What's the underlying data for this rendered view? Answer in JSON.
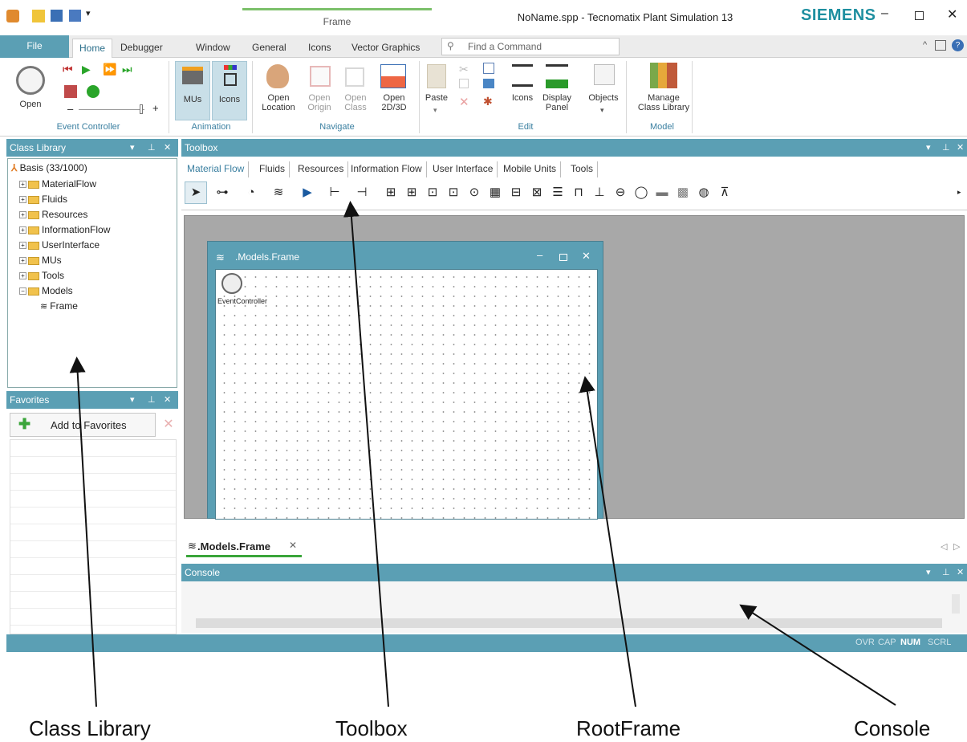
{
  "window": {
    "contextual_tab": "Frame",
    "title": "NoName.spp - Tecnomatix Plant Simulation 13",
    "brand": "SIEMENS"
  },
  "ribbon_tabs": [
    "File",
    "Home",
    "Debugger",
    "Window",
    "General",
    "Icons",
    "Vector Graphics"
  ],
  "search": {
    "placeholder": "Find a Command"
  },
  "ribbon": {
    "groups": [
      "Event Controller",
      "Animation",
      "Navigate",
      "Edit",
      "Model"
    ],
    "open_label": "Open",
    "minus": "–",
    "plus": "+",
    "mus_label": "MUs",
    "icons_label": "Icons",
    "open_location": "Open\nLocation",
    "open_origin": "Open\nOrigin",
    "open_class": "Open\nClass",
    "open_2d3d": "Open\n2D/3D",
    "paste": "Paste",
    "edit_icons": "Icons",
    "display_panel": "Display\nPanel",
    "objects": "Objects",
    "manage_class_library": "Manage\nClass Library"
  },
  "class_library": {
    "header": "Class Library",
    "root": "Basis (33/1000)",
    "items": [
      "MaterialFlow",
      "Fluids",
      "Resources",
      "InformationFlow",
      "UserInterface",
      "MUs",
      "Tools",
      "Models"
    ],
    "child": "Frame"
  },
  "favorites": {
    "header": "Favorites",
    "add_label": "Add to Favorites"
  },
  "toolbox": {
    "header": "Toolbox",
    "tabs": [
      "Material Flow",
      "Fluids",
      "Resources",
      "Information Flow",
      "User Interface",
      "Mobile Units",
      "Tools"
    ]
  },
  "frame_window": {
    "title": ".Models.Frame",
    "object_label": "EventController"
  },
  "doc_tab": {
    "label": ".Models.Frame"
  },
  "console": {
    "header": "Console"
  },
  "statusbar": {
    "items": [
      "OVR",
      "CAP",
      "NUM",
      "SCRL"
    ]
  },
  "captions": [
    "Class Library",
    "Toolbox",
    "RootFrame",
    "Console"
  ],
  "colors": {
    "panel_header": "#5b9fb4",
    "status_bar": "#5b9fb4",
    "accent": "#3a7fa0",
    "brand": "#1e8fa0",
    "canvas_gray": "#a8a8a8"
  }
}
